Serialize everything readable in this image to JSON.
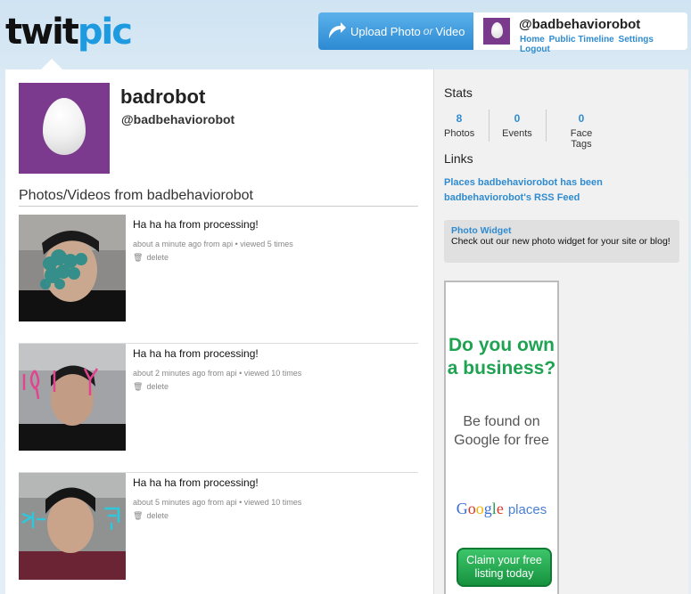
{
  "header": {
    "logo_twit": "twit",
    "logo_pic": "pic",
    "upload_label": "Upload Photo",
    "upload_or": "or",
    "upload_video": "Video",
    "username": "@badbehaviorobot",
    "nav": [
      "Home",
      "Public Timeline",
      "Settings",
      "Logout"
    ]
  },
  "profile": {
    "name": "badrobot",
    "handle": "@badbehaviorobot",
    "section_title": "Photos/Videos from badbehaviorobot"
  },
  "items": [
    {
      "message": "Ha ha ha from processing!",
      "meta": "about a minute ago from api • viewed 5 times",
      "delete": "delete"
    },
    {
      "message": "Ha ha ha from processing!",
      "meta": "about 2 minutes ago from api • viewed 10 times",
      "delete": "delete"
    },
    {
      "message": "Ha ha ha from processing!",
      "meta": "about 5 minutes ago from api • viewed 10 times",
      "delete": "delete"
    }
  ],
  "sidebar": {
    "stats_title": "Stats",
    "stats": [
      {
        "value": "8",
        "label": "Photos"
      },
      {
        "value": "0",
        "label": "Events"
      },
      {
        "value": "0",
        "label": "Face Tags"
      }
    ],
    "links_title": "Links",
    "links": [
      "Places badbehaviorobot has been",
      "badbehaviorobot's RSS Feed"
    ],
    "widget_title": "Photo Widget",
    "widget_text": "Check out our new photo widget for your site or blog!"
  },
  "ad": {
    "question": "Do you own a business?",
    "sub": "Be found on Google for free",
    "google": "Google",
    "places": "places",
    "cta": "Claim your free listing today"
  },
  "colors": {
    "accent": "#2f8bd0",
    "profile_bg": "#7b3a8d",
    "ad_green": "#1fa352"
  }
}
